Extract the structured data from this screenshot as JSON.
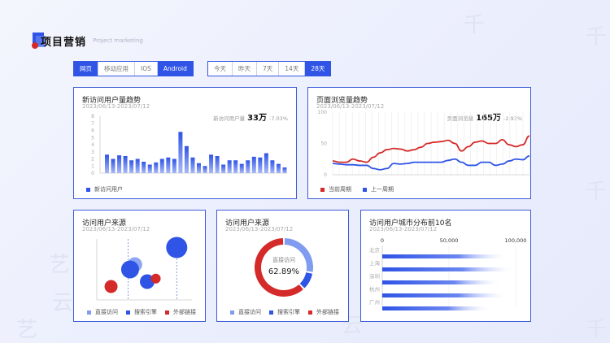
{
  "header": {
    "title": "项目营销",
    "subtitle": "Project marketing"
  },
  "platform_tabs": [
    {
      "label": "网页",
      "active": true
    },
    {
      "label": "移动应用",
      "active": false
    },
    {
      "label": "IOS",
      "active": false
    },
    {
      "label": "Android",
      "active": true
    }
  ],
  "range_tabs": [
    {
      "label": "今天",
      "active": false
    },
    {
      "label": "昨天",
      "active": false
    },
    {
      "label": "7天",
      "active": false
    },
    {
      "label": "14天",
      "active": false
    },
    {
      "label": "28天",
      "active": true
    }
  ],
  "watermark": {
    "chars": [
      "千",
      "千",
      "千",
      "艺",
      "云",
      "艺",
      "艺",
      "云",
      "千"
    ]
  },
  "colors": {
    "primary": "#2f54e6",
    "red": "#d42a2a",
    "light_blue": "#7f9cf0"
  },
  "card_new_users": {
    "title": "新访问用户量趋势",
    "date": "2023/06/13-2023/07/12",
    "stat_label": "新访问用户量",
    "stat_value": "33万",
    "stat_change": "-7.03%",
    "legend": "新访问用户"
  },
  "card_page_views": {
    "title": "页面浏览量趋势",
    "date": "2023/06/13-2023/07/12",
    "stat_label": "页面浏览量",
    "stat_value": "165万",
    "stat_change": "-2.93%",
    "legend_current": "当前周期",
    "legend_previous": "上一周期"
  },
  "card_source_bubble": {
    "title": "访问用户来源",
    "date": "2023/06/13-2023/07/12",
    "legend": [
      "直接访问",
      "搜索引擎",
      "外部链接"
    ]
  },
  "card_source_donut": {
    "title": "访问用户来源",
    "date": "2023/06/13-2023/07/12",
    "center_label": "直接访问",
    "center_value": "62.89%",
    "legend": [
      "直接访问",
      "搜索引擎",
      "外部链接"
    ]
  },
  "card_city": {
    "title": "访问用户城市分布前10名",
    "date": "2023/06/13-2023/07/12"
  },
  "chart_data": [
    {
      "type": "bar",
      "x_range": [
        0,
        30
      ],
      "ylim": [
        0,
        8
      ],
      "yticks": [
        0,
        1,
        2,
        3,
        4,
        5,
        6,
        7,
        8
      ],
      "series": [
        {
          "name": "新访问用户",
          "values": [
            2.6,
            2.0,
            2.5,
            2.4,
            1.8,
            2.0,
            1.6,
            1.2,
            1.5,
            2.0,
            2.2,
            2.0,
            5.8,
            3.8,
            2.2,
            1.4,
            1.0,
            2.6,
            2.4,
            1.2,
            1.8,
            1.8,
            1.3,
            1.8,
            2.3,
            2.2,
            2.8,
            1.8,
            1.3,
            0.8
          ]
        }
      ],
      "grid": false
    },
    {
      "type": "line",
      "x_range": [
        0,
        30
      ],
      "ylim": [
        0,
        100
      ],
      "yticks": [
        0,
        50,
        100
      ],
      "series": [
        {
          "name": "当前周期",
          "values": [
            22,
            20,
            20,
            25,
            22,
            20,
            28,
            35,
            40,
            42,
            41,
            38,
            40,
            44,
            50,
            52,
            53,
            55,
            50,
            38,
            45,
            52,
            54,
            50,
            50,
            56,
            48,
            45,
            48,
            62
          ]
        },
        {
          "name": "上一周期",
          "values": [
            18,
            17,
            16,
            16,
            15,
            15,
            10,
            8,
            10,
            18,
            17,
            18,
            20,
            20,
            20,
            20,
            20,
            23,
            25,
            20,
            15,
            15,
            20,
            20,
            15,
            17,
            22,
            25,
            24,
            30
          ]
        }
      ],
      "grid": true
    },
    {
      "type": "scatter",
      "xlim": [
        0,
        100
      ],
      "ylim": [
        0,
        100
      ],
      "series": [
        {
          "name": "直接访问",
          "points": [
            [
              40,
              58,
              9
            ]
          ]
        },
        {
          "name": "搜索引擎",
          "points": [
            [
              35,
              50,
              11
            ],
            [
              84,
              86,
              13
            ],
            [
              53,
              30,
              9
            ]
          ]
        },
        {
          "name": "外部链接",
          "points": [
            [
              15,
              22,
              8
            ],
            [
              62,
              35,
              6
            ]
          ]
        }
      ]
    },
    {
      "type": "pie",
      "slices": [
        {
          "label": "直接访问",
          "value": 28
        },
        {
          "label": "搜索引擎",
          "value": 10
        },
        {
          "label": "外部链接",
          "value": 62
        }
      ]
    },
    {
      "type": "bar",
      "orientation": "horizontal",
      "xlim": [
        0,
        100000
      ],
      "xticks": [
        {
          "value": 0,
          "label": "0"
        },
        {
          "value": 50000,
          "label": "50,000"
        },
        {
          "value": 100000,
          "label": "100,000"
        }
      ],
      "categories": [
        "北京",
        "上海",
        "深圳",
        "杭州",
        "广州"
      ],
      "values": [
        95000,
        100000,
        90000,
        95000,
        82000
      ]
    }
  ]
}
